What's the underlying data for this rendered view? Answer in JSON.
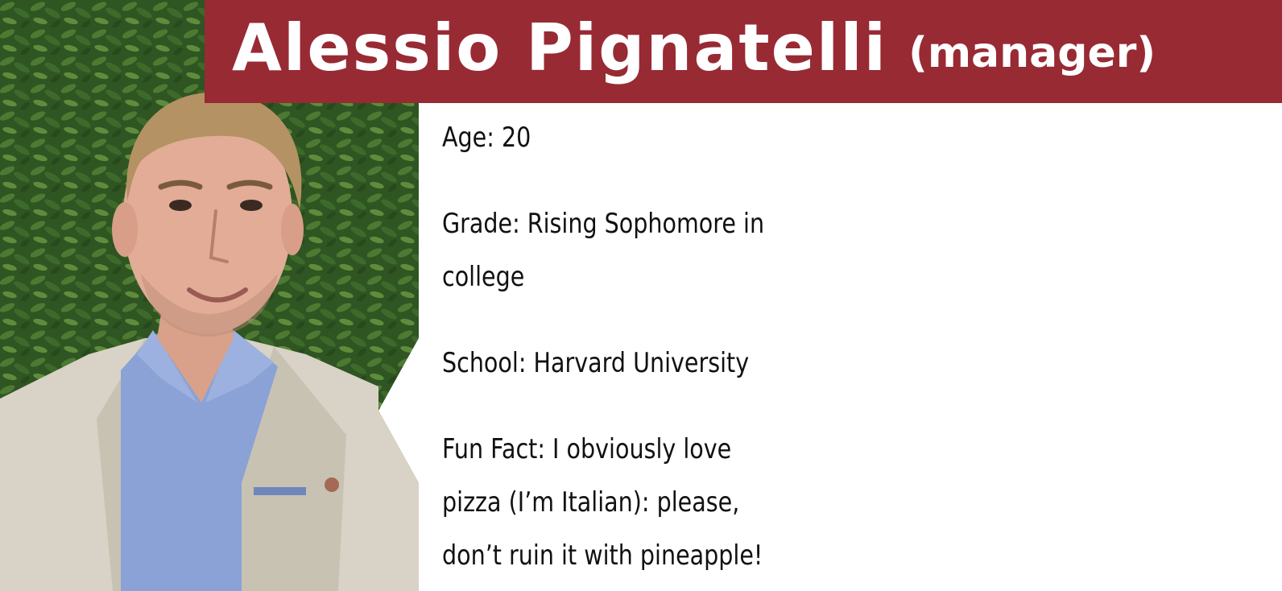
{
  "title": {
    "name": "Alessio Pignatelli",
    "role": "(manager)"
  },
  "bio": {
    "age": "Age: 20",
    "grade": "Grade: Rising Sophomore in college",
    "school": "School: Harvard University",
    "fun_fact": "Fun Fact: I obviously love pizza (I’m Italian): please, don’t ruin it with pineapple!"
  },
  "colors": {
    "banner": "#982a34",
    "title_text": "#ffffff",
    "body_text": "#111111",
    "background": "#ffffff"
  }
}
